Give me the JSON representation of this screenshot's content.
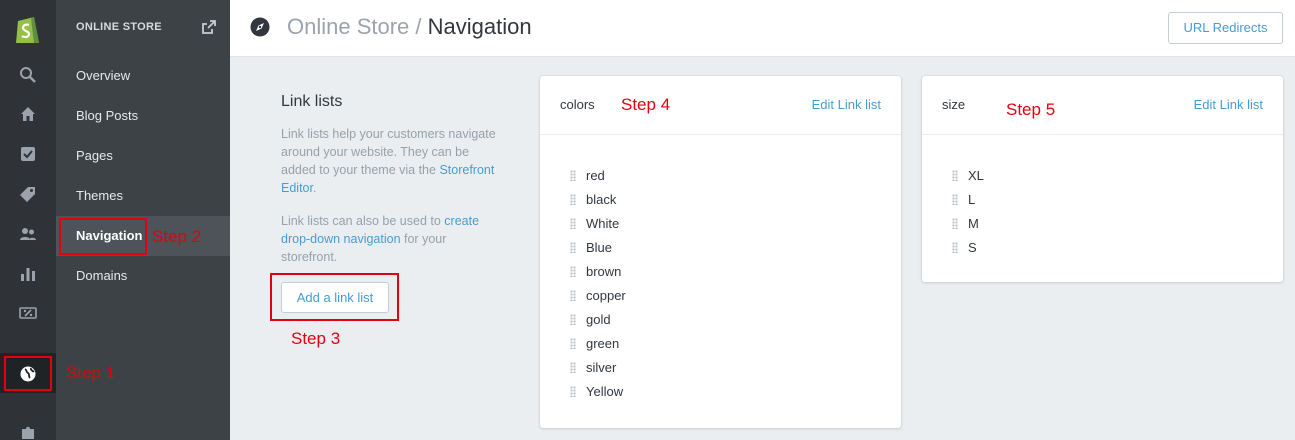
{
  "sidebar": {
    "store_title": "ONLINE STORE",
    "items": [
      {
        "label": "Overview"
      },
      {
        "label": "Blog Posts"
      },
      {
        "label": "Pages"
      },
      {
        "label": "Themes"
      },
      {
        "label": "Navigation",
        "active": true
      },
      {
        "label": "Domains"
      }
    ],
    "rail_icons": [
      "shopify-logo-icon",
      "search-icon",
      "home-icon",
      "orders-icon",
      "products-tag-icon",
      "customers-icon",
      "reports-icon",
      "discounts-icon",
      "online-store-globe-icon",
      "apps-puzzle-icon"
    ]
  },
  "header": {
    "section": "Online Store",
    "separator": " / ",
    "page": "Navigation",
    "redirects_label": "URL Redirects"
  },
  "intro": {
    "title": "Link lists",
    "p1_text": "Link lists help your customers navigate around your website. They can be added to your theme via the ",
    "p1_link": "Storefront Editor",
    "p1_end": ".",
    "p2_text": "Link lists can also be used to ",
    "p2_link": "create drop-down navigation",
    "p2_end": " for your storefront.",
    "add_button": "Add a link list"
  },
  "link_lists": [
    {
      "name": "colors",
      "edit_label": "Edit Link list",
      "items": [
        "red",
        "black",
        "White",
        "Blue",
        "brown",
        "copper",
        "gold",
        "green",
        "silver",
        "Yellow"
      ]
    },
    {
      "name": "size",
      "edit_label": "Edit Link list",
      "items": [
        "XL",
        "L",
        "M",
        "S"
      ]
    }
  ],
  "annotations": {
    "step1": "Step 1",
    "step2": "Step 2",
    "step3": "Step 3",
    "step4": "Step 4",
    "step5": "Step 5",
    "color": "#e3000f"
  },
  "colors": {
    "link": "#479ccf",
    "rail_bg": "#2f3337",
    "subnav_bg": "#3d4246"
  }
}
